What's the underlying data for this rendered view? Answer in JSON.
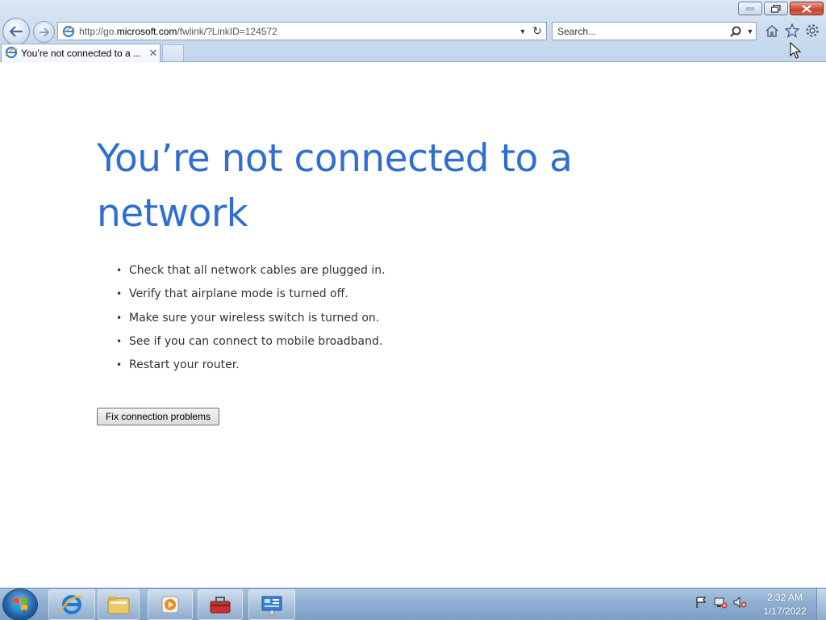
{
  "browser": {
    "address": {
      "url_prefix": "http://go.",
      "url_domain": "microsoft.com",
      "url_path": "/fwlink/?LinkID=124572",
      "icon": "ie-page-icon"
    },
    "search": {
      "placeholder": "Search...",
      "icon": "search-icon"
    },
    "tab": {
      "title": "You’re not connected to a ...",
      "close": "✕"
    },
    "toolbar_icons": [
      "home-icon",
      "favorites-star-icon",
      "tools-gear-icon"
    ],
    "window_controls": [
      "minimize",
      "restore",
      "close"
    ]
  },
  "page": {
    "headline": "You’re not connected to a network",
    "tips": [
      "Check that all network cables are plugged in.",
      "Verify that airplane mode is turned off.",
      "Make sure your wireless switch is turned on.",
      "See if you can connect to mobile broadband.",
      "Restart your router."
    ],
    "bullet": "•",
    "fix_button_label": "Fix connection problems"
  },
  "taskbar": {
    "apps": [
      "internet-explorer",
      "windows-explorer",
      "windows-media-player",
      "toolbox",
      "control-panel"
    ],
    "tray_icons": [
      "action-center-flag-icon",
      "network-disconnected-icon",
      "volume-muted-icon"
    ],
    "clock": {
      "time": "2:32 AM",
      "date": "1/17/2022"
    }
  },
  "colors": {
    "headline": "#2f6fd0",
    "chrome_bg": "#cbdcee",
    "taskbar_bg": "#8fb0d3"
  }
}
